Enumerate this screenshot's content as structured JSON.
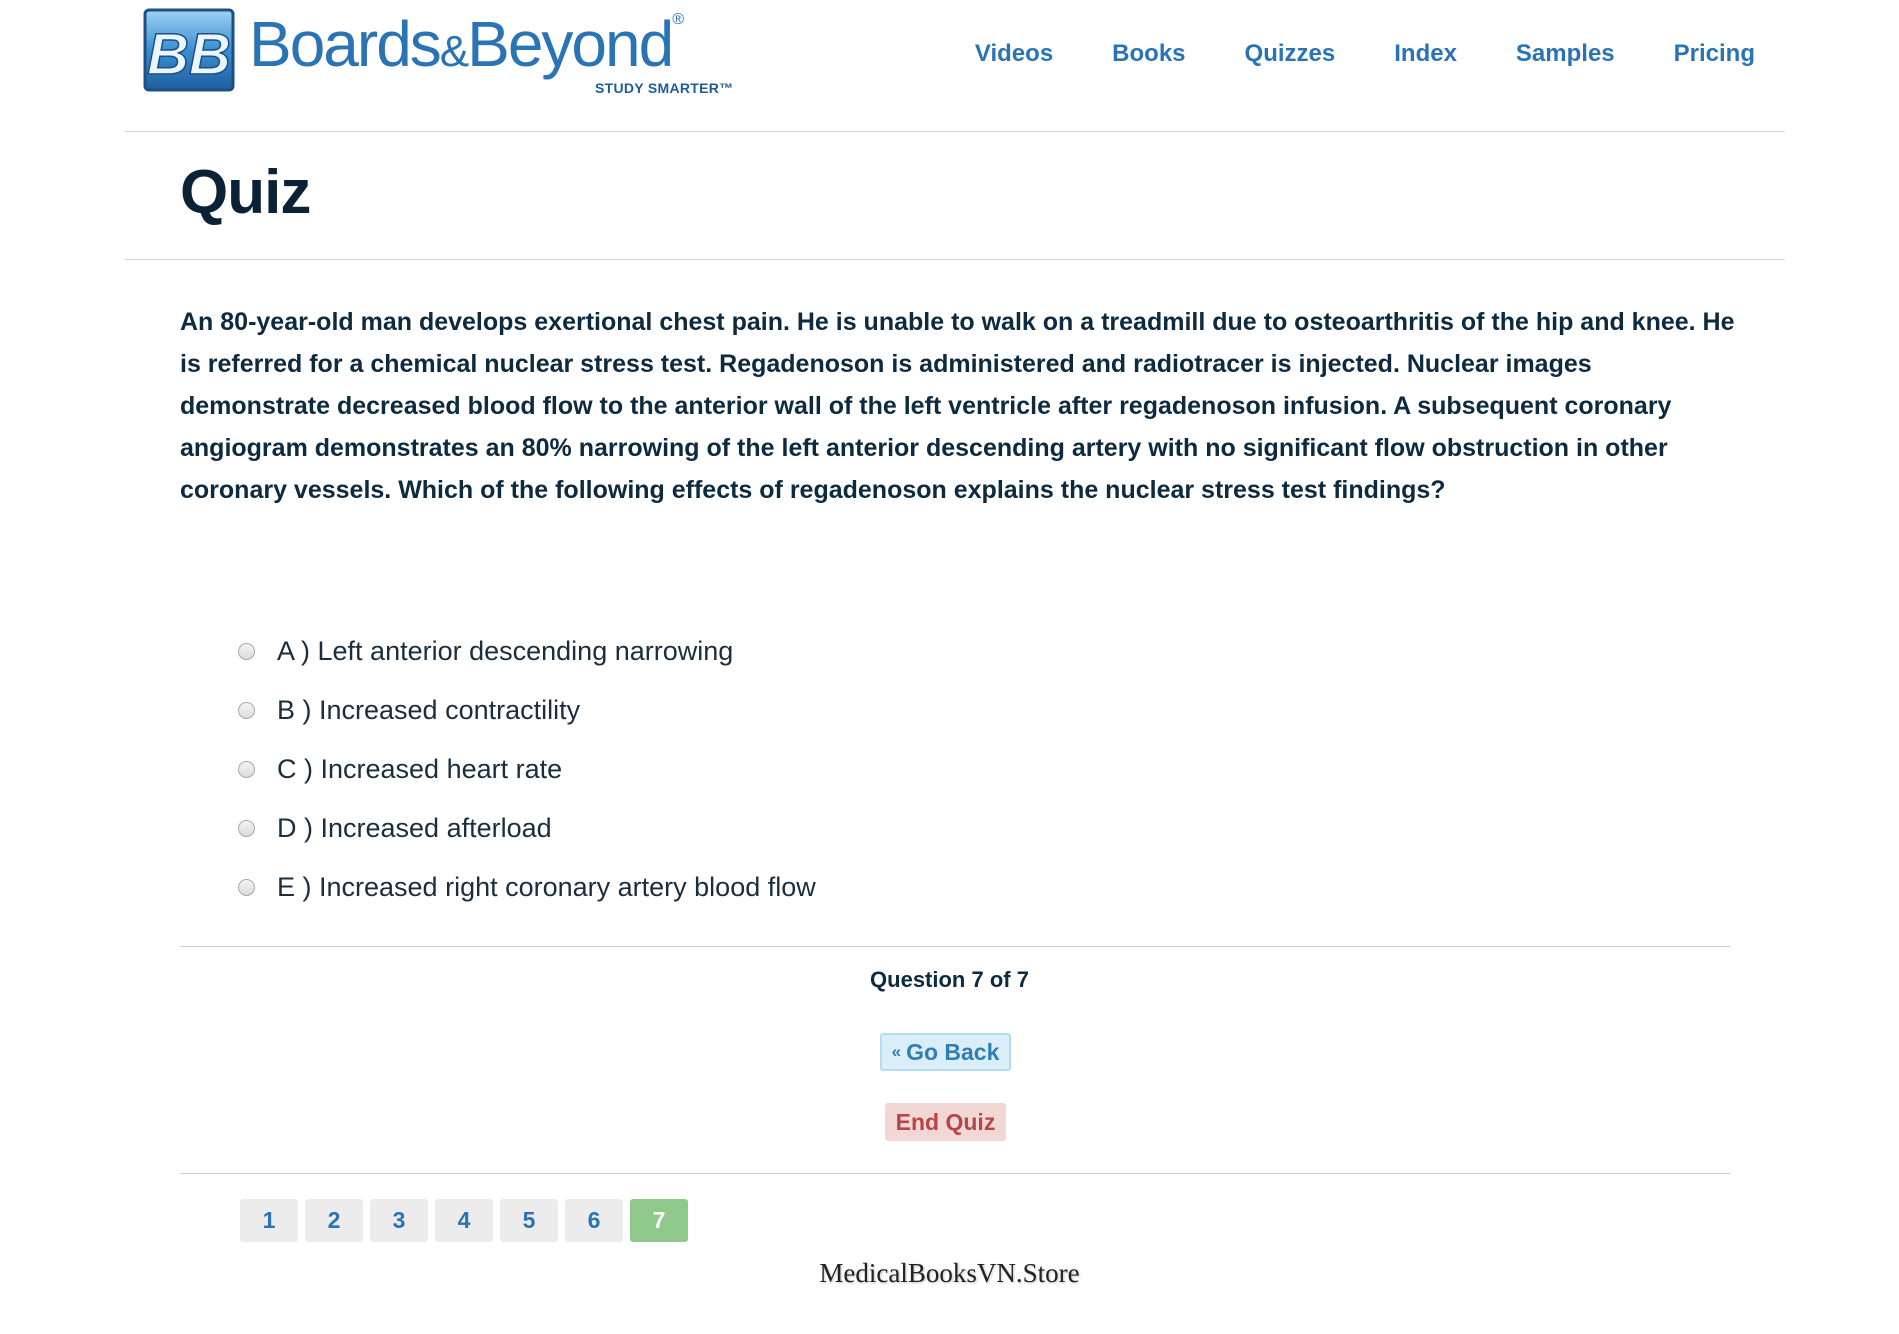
{
  "brand": {
    "badge": "BB",
    "name_part1": "Boards",
    "name_amp": "&",
    "name_part2": "Beyond",
    "registered": "®",
    "tagline": "STUDY SMARTER™"
  },
  "nav": {
    "items": [
      "Videos",
      "Books",
      "Quizzes",
      "Index",
      "Samples",
      "Pricing"
    ]
  },
  "page": {
    "title": "Quiz"
  },
  "question": {
    "text": "An 80-year-old man develops exertional chest pain. He is unable to walk on a treadmill due to osteoarthritis of the hip and knee. He is referred for a chemical nuclear stress test. Regadenoson is administered and radiotracer is injected. Nuclear images demonstrate decreased blood flow to the anterior wall of the left ventricle after regadenoson infusion. A subsequent coronary angiogram demonstrates an 80% narrowing of the left anterior descending artery with no significant flow obstruction in other coronary vessels. Which of the following effects of regadenoson explains the nuclear stress test findings?",
    "options": [
      "A ) Left anterior descending narrowing",
      "B ) Increased contractility",
      "C ) Increased heart rate",
      "D ) Increased afterload",
      "E ) Increased right coronary artery blood flow"
    ]
  },
  "progress": {
    "counter": "Question 7 of 7",
    "current": 7
  },
  "actions": {
    "back_icon": "«",
    "back_label": "Go Back",
    "end_label": "End Quiz"
  },
  "pager": {
    "pages": [
      "1",
      "2",
      "3",
      "4",
      "5",
      "6",
      "7"
    ],
    "active_index": 6
  },
  "watermark": "MedicalBooksVN.Store",
  "colors": {
    "brand_blue": "#2a73b5",
    "title_navy": "#0b2236",
    "back_bg": "#d9eef8",
    "end_bg": "#f2d7d7",
    "end_text": "#b84545",
    "active_page": "#8fc88b"
  }
}
